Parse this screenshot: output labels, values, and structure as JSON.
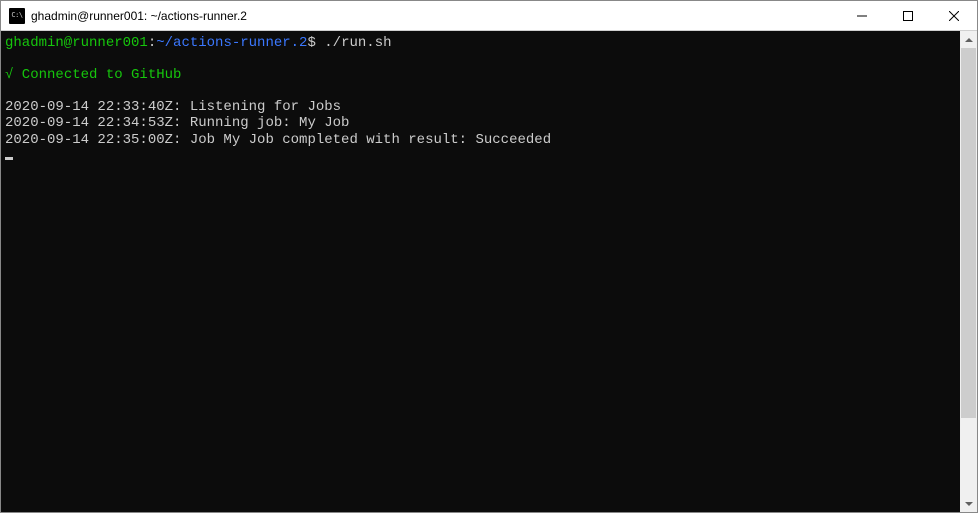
{
  "window": {
    "icon_label": "C:\\",
    "title": "ghadmin@runner001: ~/actions-runner.2"
  },
  "prompt": {
    "user_host": "ghadmin@runner001",
    "sep1": ":",
    "cwd": "~/actions-runner.2",
    "sigil": "$",
    "command": "./run.sh"
  },
  "status": {
    "check": "√",
    "text": " Connected to GitHub"
  },
  "log_lines": [
    "2020-09-14 22:33:40Z: Listening for Jobs",
    "2020-09-14 22:34:53Z: Running job: My Job",
    "2020-09-14 22:35:00Z: Job My Job completed with result: Succeeded"
  ]
}
